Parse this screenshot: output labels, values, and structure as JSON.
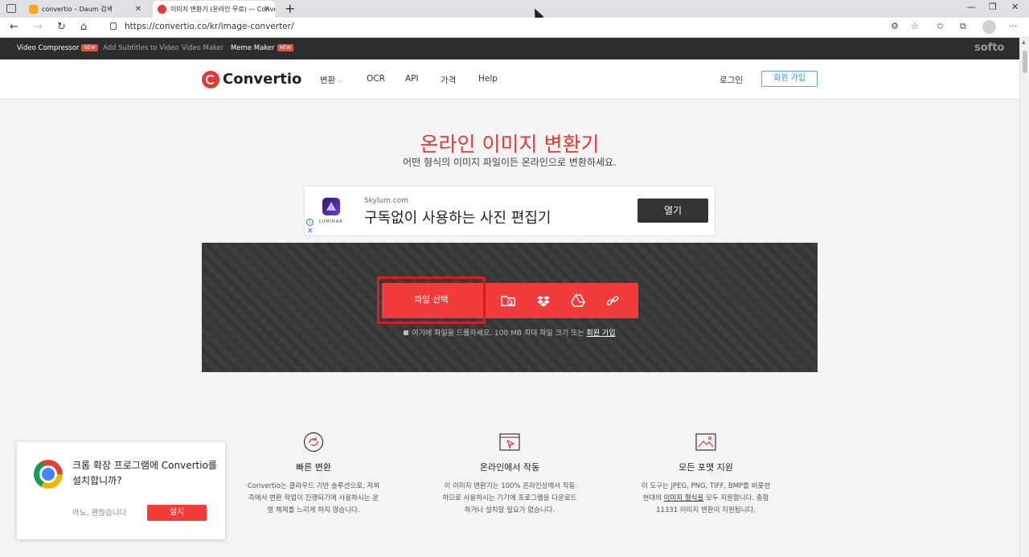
{
  "browser": {
    "tabs": [
      {
        "title": "convertio – Daum 검색",
        "favicon_color": "#f5a623"
      },
      {
        "title": "이미지 변환기 (온라인 무료) — Convertio",
        "favicon_color": "#e53935"
      }
    ],
    "new_tab": "+",
    "window_controls": {
      "minimize": "—",
      "maximize": "❐",
      "close": "✕"
    },
    "nav": {
      "back": "←",
      "forward": "→",
      "reload": "↻",
      "home": "⌂"
    },
    "url": "https://convertio.co/kr/image-converter/",
    "tools": {
      "site_info": "⚙",
      "favorite": "☆",
      "favorites": "✩",
      "collections": "⧉",
      "menu": "···"
    }
  },
  "topstrip": {
    "items": [
      {
        "label": "Video Compressor",
        "badge": "NEW"
      },
      {
        "label": "Add Subtitles to Video",
        "badge": ""
      },
      {
        "label": "Video Maker",
        "badge": ""
      },
      {
        "label": "Meme Maker",
        "badge": "NEW"
      }
    ],
    "brand": "softo"
  },
  "header": {
    "logo": "Convertio",
    "nav": [
      {
        "label": "변환",
        "has_dropdown": true,
        "chevron": "⌵"
      },
      {
        "label": "OCR"
      },
      {
        "label": "API"
      },
      {
        "label": "가격"
      },
      {
        "label": "Help"
      }
    ],
    "login": "로그인",
    "signup": "회원 가입"
  },
  "hero": {
    "title": "온라인 이미지 변환기",
    "subtitle": "어떤 형식의 이미지 파일이든 온라인으로 변환하세요."
  },
  "ad": {
    "brand_mark": "LUMINAR",
    "domain": "Skylum.com",
    "headline": "구독없이 사용하는 사진 편집기",
    "cta": "열기",
    "info": "i",
    "close": "✕"
  },
  "upload": {
    "choose_file": "파일 선택",
    "icons": [
      "folder-search-icon",
      "dropbox-icon",
      "google-drive-icon",
      "link-icon"
    ],
    "drop_hint": "여기에 파일을 드롭하세요. 100 MB 최대 파일 크기 또는",
    "drop_hint_link": "회원 가입"
  },
  "features": [
    {
      "title": "빠른 변환",
      "desc_before": "Convertio는 클라우드 기반 솔루션으로, 저희 측에서 변환 작업이 진행되기에 사용하시는 운영 체제를 느리게 하지 않습니다.",
      "desc_link": "",
      "desc_after": ""
    },
    {
      "title": "온라인에서 작동",
      "desc_before": "이 이미지 변환기는 100% 온라인상에서 작동하므로 사용하시는 기기에 프로그램을 다운로드하거나 설치할 필요가 없습니다.",
      "desc_link": "",
      "desc_after": ""
    },
    {
      "title": "모든 포맷 지원",
      "desc_before": "이 도구는 JPEG, PNG, TIFF, BMP를 비롯한 현대의 ",
      "desc_link": "이미지 형식을",
      "desc_after": " 모두 지원합니다. 총합 11331 이미지 변환이 지원됩니다."
    }
  ],
  "popup": {
    "message": "크롬 확장 프로그램에 Convertio를 설치합니까?",
    "decline": "아뇨, 괜찮습니다",
    "accept": "설치"
  },
  "colors": {
    "brand_red": "#e53935",
    "button_red": "#f23c3c",
    "dark_strip": "#2d2d2d",
    "signup_blue": "#3b8ed6"
  }
}
